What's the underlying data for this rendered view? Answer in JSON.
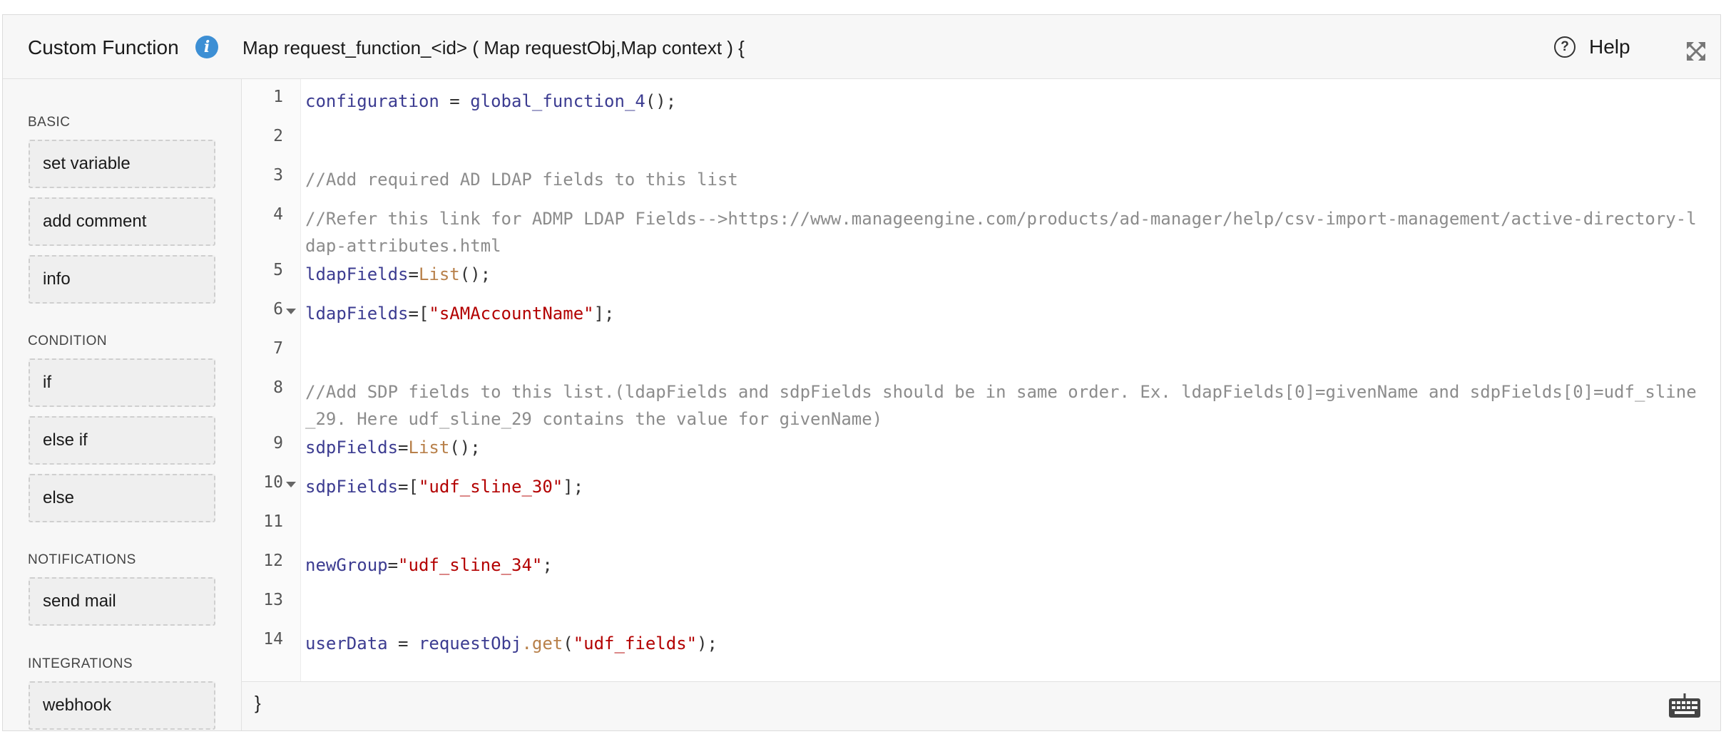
{
  "header": {
    "title": "Custom Function",
    "signature": "Map request_function_<id> ( Map requestObj,Map context ) {",
    "help_label": "Help"
  },
  "sidebar": {
    "sections": [
      {
        "name": "BASIC",
        "items": [
          "set variable",
          "add comment",
          "info"
        ]
      },
      {
        "name": "CONDITION",
        "items": [
          "if",
          "else if",
          "else"
        ]
      },
      {
        "name": "NOTIFICATIONS",
        "items": [
          "send mail"
        ]
      },
      {
        "name": "INTEGRATIONS",
        "items": [
          "webhook"
        ]
      }
    ]
  },
  "editor": {
    "lines": [
      {
        "n": "1",
        "fold": false,
        "tokens": [
          [
            "var",
            "configuration"
          ],
          [
            "punc",
            " = "
          ],
          [
            "var",
            "global_function_4"
          ],
          [
            "punc",
            "();"
          ]
        ]
      },
      {
        "n": "2",
        "fold": false,
        "tokens": []
      },
      {
        "n": "3",
        "fold": false,
        "tokens": [
          [
            "cmt",
            "//Add required AD LDAP fields to this list"
          ]
        ]
      },
      {
        "n": "4",
        "fold": false,
        "tokens": [
          [
            "cmt",
            "//Refer this link for ADMP LDAP Fields-->https://www.manageengine.com/products/ad-manager/help/csv-import-management/active-directory-ldap-attributes.html"
          ]
        ]
      },
      {
        "n": "5",
        "fold": false,
        "tokens": [
          [
            "var",
            "ldapFields"
          ],
          [
            "punc",
            "="
          ],
          [
            "fn",
            "List"
          ],
          [
            "punc",
            "();"
          ]
        ]
      },
      {
        "n": "6",
        "fold": true,
        "tokens": [
          [
            "var",
            "ldapFields"
          ],
          [
            "punc",
            "=["
          ],
          [
            "str",
            "\"sAMAccountName\""
          ],
          [
            "punc",
            "];"
          ]
        ]
      },
      {
        "n": "7",
        "fold": false,
        "tokens": []
      },
      {
        "n": "8",
        "fold": false,
        "tokens": [
          [
            "cmt",
            "//Add SDP fields to this list.(ldapFields and sdpFields should be in same order. Ex. ldapFields[0]=givenName and sdpFields[0]=udf_sline_29. Here udf_sline_29 contains the value for givenName)"
          ]
        ]
      },
      {
        "n": "9",
        "fold": false,
        "tokens": [
          [
            "var",
            "sdpFields"
          ],
          [
            "punc",
            "="
          ],
          [
            "fn",
            "List"
          ],
          [
            "punc",
            "();"
          ]
        ]
      },
      {
        "n": "10",
        "fold": true,
        "tokens": [
          [
            "var",
            "sdpFields"
          ],
          [
            "punc",
            "=["
          ],
          [
            "str",
            "\"udf_sline_30\""
          ],
          [
            "punc",
            "];"
          ]
        ]
      },
      {
        "n": "11",
        "fold": false,
        "tokens": []
      },
      {
        "n": "12",
        "fold": false,
        "tokens": [
          [
            "var",
            "newGroup"
          ],
          [
            "punc",
            "="
          ],
          [
            "str",
            "\"udf_sline_34\""
          ],
          [
            "punc",
            ";"
          ]
        ]
      },
      {
        "n": "13",
        "fold": false,
        "tokens": []
      },
      {
        "n": "14",
        "fold": false,
        "tokens": [
          [
            "var",
            "userData"
          ],
          [
            "punc",
            " = "
          ],
          [
            "var",
            "requestObj"
          ],
          [
            "fn",
            ".get"
          ],
          [
            "punc",
            "("
          ],
          [
            "str",
            "\"udf_fields\""
          ],
          [
            "punc",
            ");"
          ]
        ]
      }
    ]
  },
  "footer": {
    "closing_brace": "}"
  },
  "colors": {
    "variable": "#3c3c91",
    "function": "#b8804a",
    "string": "#b30000",
    "comment": "#8c8c8c",
    "info_icon": "#3d8fd4"
  }
}
